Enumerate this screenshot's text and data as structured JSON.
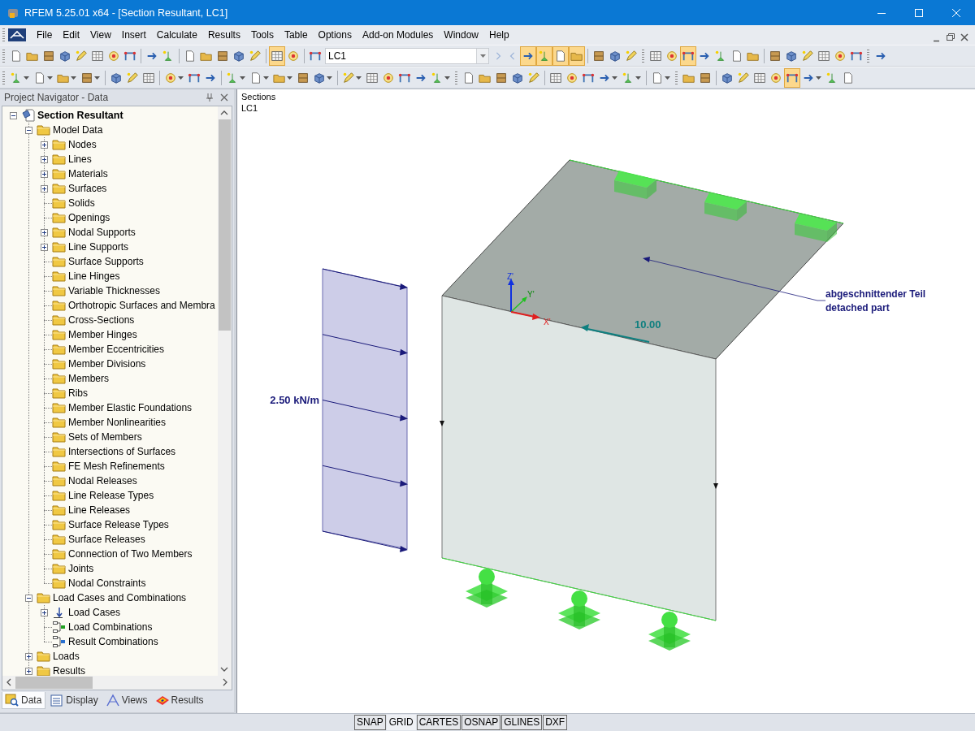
{
  "window": {
    "title": "RFEM 5.25.01 x64 - [Section Resultant, LC1]"
  },
  "menu": [
    "File",
    "Edit",
    "View",
    "Insert",
    "Calculate",
    "Results",
    "Tools",
    "Table",
    "Options",
    "Add-on Modules",
    "Window",
    "Help"
  ],
  "toolbars": [
    {
      "items": [
        {
          "kind": "button",
          "pressed": false
        },
        {
          "kind": "button",
          "pressed": false
        },
        {
          "kind": "button",
          "pressed": false
        },
        {
          "kind": "button",
          "pressed": false
        },
        {
          "kind": "button",
          "pressed": false
        },
        {
          "kind": "button",
          "pressed": false
        },
        {
          "kind": "button",
          "pressed": false
        },
        {
          "kind": "button",
          "pressed": false
        },
        {
          "kind": "sep"
        },
        {
          "kind": "button",
          "pressed": false
        },
        {
          "kind": "button",
          "pressed": false
        },
        {
          "kind": "sep"
        },
        {
          "kind": "button",
          "pressed": false
        },
        {
          "kind": "button",
          "pressed": false
        },
        {
          "kind": "button",
          "pressed": false
        },
        {
          "kind": "button",
          "pressed": false
        },
        {
          "kind": "button",
          "pressed": false
        },
        {
          "kind": "sep"
        },
        {
          "kind": "button",
          "pressed": true
        },
        {
          "kind": "button",
          "pressed": false
        },
        {
          "kind": "sep"
        },
        {
          "kind": "button",
          "pressed": false
        },
        {
          "kind": "select",
          "value": "LC1"
        },
        {
          "kind": "nav"
        },
        {
          "kind": "nav"
        },
        {
          "kind": "button",
          "pressed": true
        },
        {
          "kind": "button",
          "pressed": true
        },
        {
          "kind": "button",
          "pressed": true
        },
        {
          "kind": "button",
          "pressed": true
        },
        {
          "kind": "sep"
        },
        {
          "kind": "button",
          "pressed": false
        },
        {
          "kind": "button",
          "pressed": false
        },
        {
          "kind": "button",
          "pressed": false
        },
        {
          "kind": "grip"
        },
        {
          "kind": "button",
          "pressed": false
        },
        {
          "kind": "button",
          "pressed": false
        },
        {
          "kind": "button",
          "pressed": true
        },
        {
          "kind": "button",
          "pressed": false
        },
        {
          "kind": "button",
          "pressed": false
        },
        {
          "kind": "button",
          "pressed": false
        },
        {
          "kind": "button",
          "pressed": false
        },
        {
          "kind": "sep"
        },
        {
          "kind": "button",
          "pressed": false
        },
        {
          "kind": "button",
          "pressed": false
        },
        {
          "kind": "button",
          "pressed": false
        },
        {
          "kind": "button",
          "pressed": false
        },
        {
          "kind": "button",
          "pressed": false
        },
        {
          "kind": "button",
          "pressed": false
        },
        {
          "kind": "grip"
        },
        {
          "kind": "button",
          "pressed": false
        }
      ]
    },
    {
      "items": [
        {
          "kind": "split",
          "pressed": false
        },
        {
          "kind": "split",
          "pressed": false
        },
        {
          "kind": "split",
          "pressed": false
        },
        {
          "kind": "split",
          "pressed": false
        },
        {
          "kind": "sep"
        },
        {
          "kind": "button",
          "pressed": false
        },
        {
          "kind": "button",
          "pressed": false
        },
        {
          "kind": "button",
          "pressed": false
        },
        {
          "kind": "sep"
        },
        {
          "kind": "split",
          "pressed": false
        },
        {
          "kind": "button",
          "pressed": false
        },
        {
          "kind": "button",
          "pressed": false
        },
        {
          "kind": "sep"
        },
        {
          "kind": "split",
          "pressed": false
        },
        {
          "kind": "split",
          "pressed": false
        },
        {
          "kind": "split",
          "pressed": false
        },
        {
          "kind": "button",
          "pressed": false
        },
        {
          "kind": "split",
          "pressed": false
        },
        {
          "kind": "sep"
        },
        {
          "kind": "split",
          "pressed": false
        },
        {
          "kind": "button",
          "pressed": false
        },
        {
          "kind": "button",
          "pressed": false
        },
        {
          "kind": "button",
          "pressed": false
        },
        {
          "kind": "button",
          "pressed": false
        },
        {
          "kind": "split",
          "pressed": false
        },
        {
          "kind": "grip"
        },
        {
          "kind": "button",
          "pressed": false
        },
        {
          "kind": "button",
          "pressed": false
        },
        {
          "kind": "button",
          "pressed": false
        },
        {
          "kind": "button",
          "pressed": false
        },
        {
          "kind": "button",
          "pressed": false
        },
        {
          "kind": "sep"
        },
        {
          "kind": "button",
          "pressed": false
        },
        {
          "kind": "button",
          "pressed": false
        },
        {
          "kind": "button",
          "pressed": false
        },
        {
          "kind": "split",
          "pressed": false
        },
        {
          "kind": "split",
          "pressed": false
        },
        {
          "kind": "sep"
        },
        {
          "kind": "split",
          "pressed": false
        },
        {
          "kind": "grip"
        },
        {
          "kind": "button",
          "pressed": false
        },
        {
          "kind": "button",
          "pressed": false
        },
        {
          "kind": "sep"
        },
        {
          "kind": "button",
          "pressed": false
        },
        {
          "kind": "button",
          "pressed": false
        },
        {
          "kind": "button",
          "pressed": false
        },
        {
          "kind": "button",
          "pressed": false
        },
        {
          "kind": "button",
          "pressed": true
        },
        {
          "kind": "split",
          "pressed": false
        },
        {
          "kind": "button",
          "pressed": false
        },
        {
          "kind": "button",
          "pressed": false
        }
      ]
    }
  ],
  "navigator": {
    "title": "Project Navigator - Data",
    "tree": [
      {
        "label": "Section Resultant",
        "kind": "model",
        "expandable": true,
        "expanded": true,
        "children": [
          {
            "label": "Model Data",
            "kind": "folder",
            "expandable": true,
            "expanded": true,
            "children": [
              {
                "label": "Nodes",
                "kind": "folder",
                "expandable": true,
                "expanded": false
              },
              {
                "label": "Lines",
                "kind": "folder",
                "expandable": true,
                "expanded": false
              },
              {
                "label": "Materials",
                "kind": "folder",
                "expandable": true,
                "expanded": false
              },
              {
                "label": "Surfaces",
                "kind": "folder",
                "expandable": true,
                "expanded": false
              },
              {
                "label": "Solids",
                "kind": "folder",
                "expandable": false
              },
              {
                "label": "Openings",
                "kind": "folder",
                "expandable": false
              },
              {
                "label": "Nodal Supports",
                "kind": "folder",
                "expandable": true,
                "expanded": false
              },
              {
                "label": "Line Supports",
                "kind": "folder",
                "expandable": true,
                "expanded": false
              },
              {
                "label": "Surface Supports",
                "kind": "folder",
                "expandable": false
              },
              {
                "label": "Line Hinges",
                "kind": "folder",
                "expandable": false
              },
              {
                "label": "Variable Thicknesses",
                "kind": "folder",
                "expandable": false
              },
              {
                "label": "Orthotropic Surfaces and Membra",
                "kind": "folder",
                "expandable": false
              },
              {
                "label": "Cross-Sections",
                "kind": "folder",
                "expandable": false
              },
              {
                "label": "Member Hinges",
                "kind": "folder",
                "expandable": false
              },
              {
                "label": "Member Eccentricities",
                "kind": "folder",
                "expandable": false
              },
              {
                "label": "Member Divisions",
                "kind": "folder",
                "expandable": false
              },
              {
                "label": "Members",
                "kind": "folder",
                "expandable": false
              },
              {
                "label": "Ribs",
                "kind": "folder",
                "expandable": false
              },
              {
                "label": "Member Elastic Foundations",
                "kind": "folder",
                "expandable": false
              },
              {
                "label": "Member Nonlinearities",
                "kind": "folder",
                "expandable": false
              },
              {
                "label": "Sets of Members",
                "kind": "folder",
                "expandable": false
              },
              {
                "label": "Intersections of Surfaces",
                "kind": "folder",
                "expandable": false
              },
              {
                "label": "FE Mesh Refinements",
                "kind": "folder",
                "expandable": false
              },
              {
                "label": "Nodal Releases",
                "kind": "folder",
                "expandable": false
              },
              {
                "label": "Line Release Types",
                "kind": "folder",
                "expandable": false
              },
              {
                "label": "Line Releases",
                "kind": "folder",
                "expandable": false
              },
              {
                "label": "Surface Release Types",
                "kind": "folder",
                "expandable": false
              },
              {
                "label": "Surface Releases",
                "kind": "folder",
                "expandable": false
              },
              {
                "label": "Connection of Two Members",
                "kind": "folder",
                "expandable": false
              },
              {
                "label": "Joints",
                "kind": "folder",
                "expandable": false
              },
              {
                "label": "Nodal Constraints",
                "kind": "folder",
                "expandable": false
              }
            ]
          },
          {
            "label": "Load Cases and Combinations",
            "kind": "folder",
            "expandable": true,
            "expanded": true,
            "children": [
              {
                "label": "Load Cases",
                "kind": "load",
                "expandable": true,
                "expanded": false
              },
              {
                "label": "Load Combinations",
                "kind": "combination",
                "expandable": false
              },
              {
                "label": "Result Combinations",
                "kind": "result-combination",
                "expandable": false
              }
            ]
          },
          {
            "label": "Loads",
            "kind": "folder",
            "expandable": true,
            "expanded": false
          },
          {
            "label": "Results",
            "kind": "folder",
            "expandable": true,
            "expanded": false
          }
        ]
      }
    ],
    "tabs": [
      {
        "label": "Data",
        "selected": true
      },
      {
        "label": "Display",
        "selected": false
      },
      {
        "label": "Views",
        "selected": false
      },
      {
        "label": "Results",
        "selected": false
      }
    ]
  },
  "view": {
    "caption": [
      "Sections",
      "LC1"
    ],
    "load_label": "2.50 kN/m",
    "force_value": "10.00",
    "annotation": [
      "abgeschnittender Teil",
      "detached part"
    ],
    "axes": {
      "x": "X'",
      "y": "Y'",
      "z": "Z'"
    }
  },
  "status_bar": [
    {
      "label": "SNAP",
      "on": false
    },
    {
      "label": "GRID",
      "on": true
    },
    {
      "label": "CARTES",
      "on": false
    },
    {
      "label": "OSNAP",
      "on": false
    },
    {
      "label": "GLINES",
      "on": false
    },
    {
      "label": "DXF",
      "on": false
    }
  ]
}
